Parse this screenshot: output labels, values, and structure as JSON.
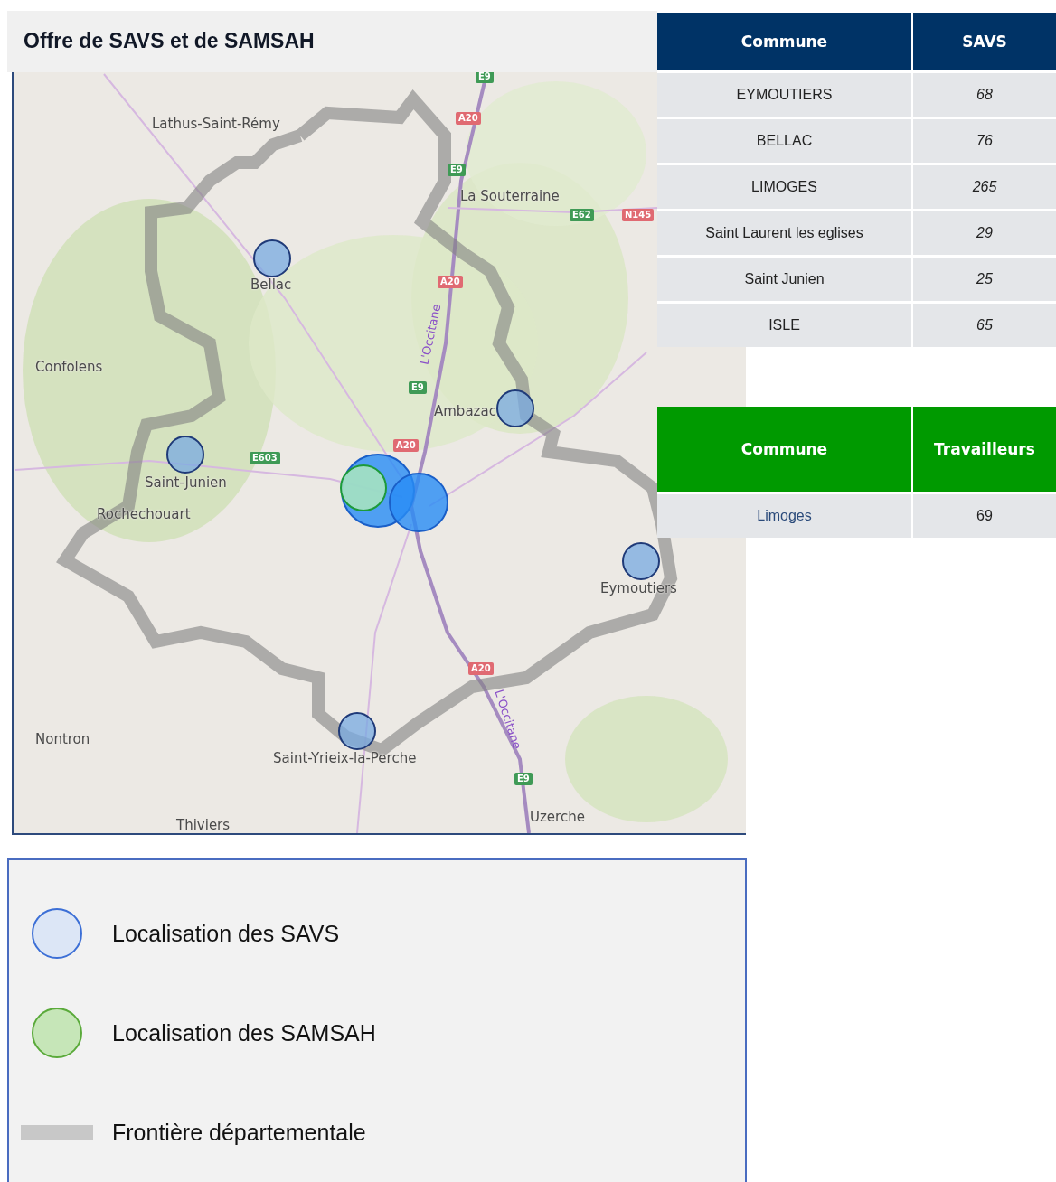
{
  "title": "Offre de SAVS et de SAMSAH",
  "map": {
    "places": [
      "Lathus-Saint-Rémy",
      "La Souterraine",
      "Bellac",
      "Confolens",
      "Ambazac",
      "Saint-Junien",
      "Rochechouart",
      "Eymoutiers",
      "Saint-Yrieix-la-Perche",
      "Nontron",
      "Uzerche",
      "Thiviers"
    ],
    "road_labels": [
      "L'Occitane",
      "L'Occitane"
    ],
    "shields": [
      {
        "label": "E9",
        "kind": "european"
      },
      {
        "label": "A20",
        "kind": "national"
      },
      {
        "label": "E9",
        "kind": "european"
      },
      {
        "label": "E62",
        "kind": "european"
      },
      {
        "label": "N145",
        "kind": "national"
      },
      {
        "label": "A20",
        "kind": "national"
      },
      {
        "label": "E9",
        "kind": "european"
      },
      {
        "label": "A20",
        "kind": "national"
      },
      {
        "label": "E603",
        "kind": "european"
      },
      {
        "label": "A20",
        "kind": "national"
      },
      {
        "label": "E9",
        "kind": "european"
      }
    ],
    "markers": [
      {
        "kind": "savs"
      },
      {
        "kind": "savs"
      },
      {
        "kind": "savs"
      },
      {
        "kind": "savs"
      },
      {
        "kind": "savs"
      },
      {
        "kind": "savs"
      },
      {
        "kind": "savs"
      },
      {
        "kind": "samsah"
      }
    ]
  },
  "savs_table": {
    "columns": [
      "Commune",
      "SAVS"
    ],
    "rows": [
      [
        "EYMOUTIERS",
        "68"
      ],
      [
        "BELLAC",
        "76"
      ],
      [
        "LIMOGES",
        "265"
      ],
      [
        "Saint Laurent les eglises",
        "29"
      ],
      [
        "Saint Junien",
        "25"
      ],
      [
        "ISLE",
        "65"
      ]
    ]
  },
  "samsah_table": {
    "columns": [
      "Commune",
      "Travailleurs"
    ],
    "rows": [
      [
        "Limoges",
        "69"
      ]
    ]
  },
  "legend": [
    {
      "kind": "savs",
      "label": "Localisation des SAVS"
    },
    {
      "kind": "samsah",
      "label": "Localisation des SAMSAH"
    },
    {
      "kind": "border",
      "label": "Frontière départementale"
    }
  ]
}
